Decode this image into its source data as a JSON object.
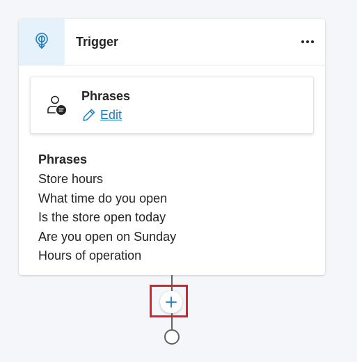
{
  "trigger_node": {
    "title": "Trigger",
    "icon": "touch-pointer-icon",
    "more_icon": "more-horizontal-icon"
  },
  "phrases_card": {
    "title": "Phrases",
    "icon": "person-chat-icon",
    "edit_label": "Edit",
    "edit_icon": "pencil-icon"
  },
  "phrases_list": {
    "heading": "Phrases",
    "items": [
      "Store hours",
      "What time do you open",
      "Is the store open today",
      "Are you open on Sunday",
      "Hours of operation"
    ]
  },
  "add_node": {
    "icon": "plus-icon"
  },
  "colors": {
    "accent": "#1a7bbf",
    "icon_box_bg": "#e6f2fb",
    "highlight": "#d8222a",
    "connector": "#616161"
  }
}
